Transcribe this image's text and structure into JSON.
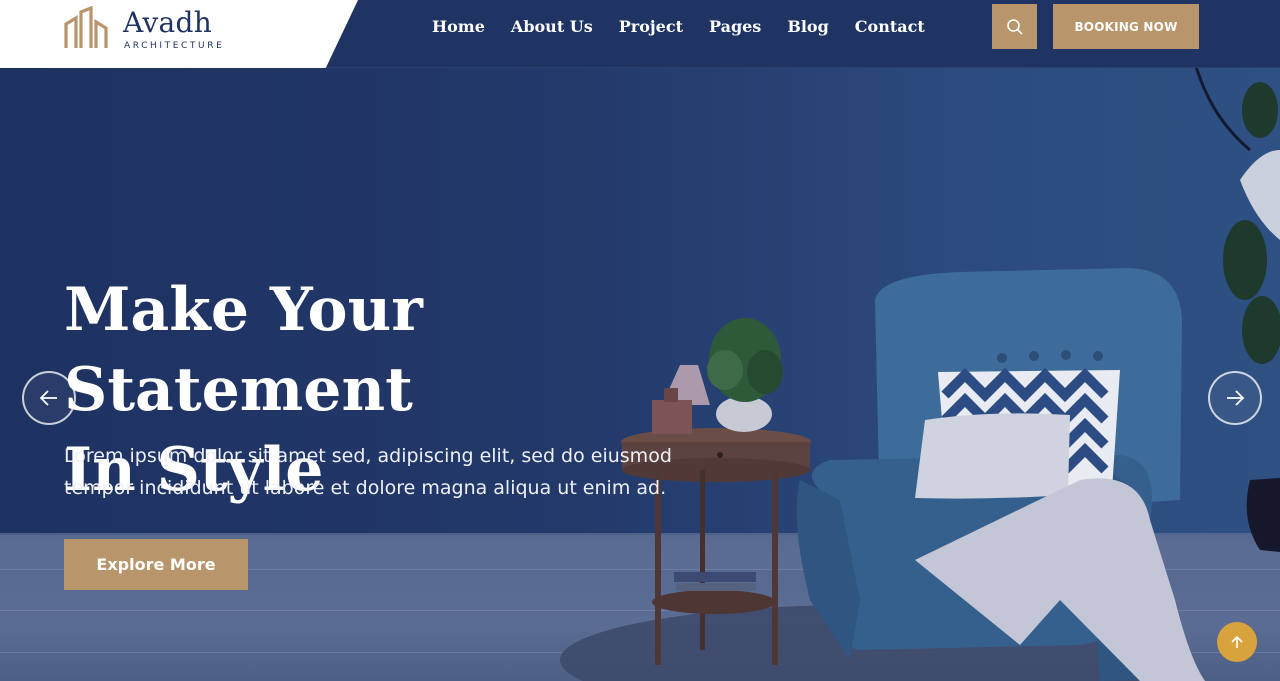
{
  "brand": {
    "name": "Avadh",
    "tagline": "ARCHITECTURE",
    "accent_color": "#b8956a",
    "navy_color": "#1f3463"
  },
  "nav": {
    "items": [
      {
        "label": "Home"
      },
      {
        "label": "About Us"
      },
      {
        "label": "Project"
      },
      {
        "label": "Pages"
      },
      {
        "label": "Blog"
      },
      {
        "label": "Contact"
      }
    ]
  },
  "header": {
    "search_icon": "search-icon",
    "booking_label": "BOOKING NOW"
  },
  "hero": {
    "headline_line1": "Make Your Statement",
    "headline_line2": "In Style",
    "description_line1": "Lorem ipsum dolor sit amet sed, adipiscing elit, sed do eiusmod",
    "description_line2": "tempor incididunt ut labore et dolore magna aliqua ut enim ad.",
    "cta_label": "Explore More",
    "prev_icon": "arrow-left-icon",
    "next_icon": "arrow-right-icon"
  },
  "scroll_top": {
    "icon": "arrow-up-icon",
    "color": "#d8a23c"
  }
}
